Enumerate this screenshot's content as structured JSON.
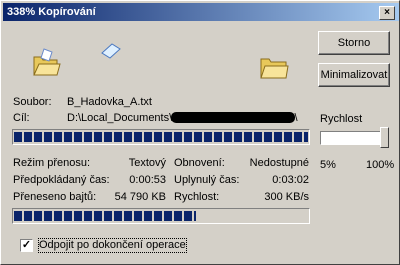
{
  "window": {
    "title": "338% Kopírování",
    "close_symbol": "×"
  },
  "buttons": {
    "cancel": "Storno",
    "minimize": "Minimalizovat"
  },
  "file": {
    "source_label": "Soubor:",
    "source_value": "B_Hadovka_A.txt",
    "dest_label": "Cíl:",
    "dest_value_start": "D:\\Local_Documents\\",
    "dest_value_end": "s\\"
  },
  "progress": {
    "file_fraction": 1.0,
    "total_fraction": 0.62
  },
  "speed": {
    "label": "Rychlost",
    "min": "5%",
    "max": "100%",
    "level": 1.0
  },
  "stats": {
    "mode_label": "Režim přenosu:",
    "mode_value": "Textový",
    "estimated_label": "Předpokládaný čas:",
    "estimated_value": "0:00:53",
    "transferred_label": "Přeneseno bajtů:",
    "transferred_value": "54 790 KB",
    "refresh_label": "Obnovení:",
    "refresh_value": "Nedostupné",
    "elapsed_label": "Uplynulý čas:",
    "elapsed_value": "0:03:02",
    "rate_label": "Rychlost:",
    "rate_value": "300 KB/s"
  },
  "option": {
    "disconnect_label": "Odpojit po dokončení operace",
    "checked_symbol": "✓"
  },
  "icons": {
    "source": "folder-open-icon",
    "flying": "paper-icon",
    "target": "folder-icon"
  }
}
